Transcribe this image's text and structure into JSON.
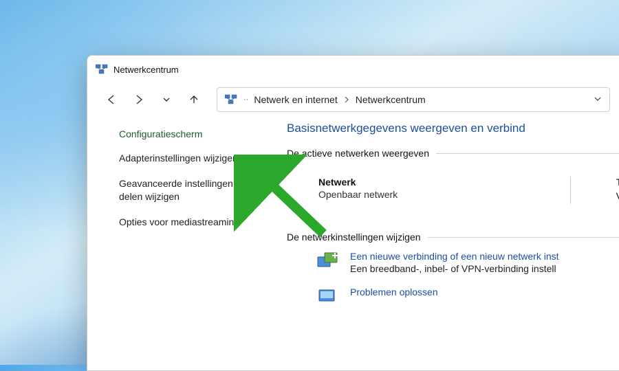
{
  "window": {
    "title": "Netwerkcentrum"
  },
  "breadcrumb": {
    "parent": "Netwerk en internet",
    "current": "Netwerkcentrum"
  },
  "sidebar": {
    "heading": "Configuratiescherm",
    "links": {
      "adapter": "Adapterinstellingen wijzigen",
      "advanced_sharing": "Geavanceerde instellingen voor delen wijzigen",
      "media_streaming": "Opties voor mediastreaming"
    }
  },
  "main": {
    "heading": "Basisnetwerkgegevens weergeven en verbind",
    "active_networks_label": "De actieve netwerken weergeven",
    "network": {
      "name": "Netwerk",
      "type": "Openbaar netwerk",
      "col1": "T",
      "col2": "V"
    },
    "change_settings_label": "De netwerkinstellingen wijzigen",
    "new_connection": {
      "link": "Een nieuwe verbinding of een nieuw netwerk inst",
      "desc": "Een breedband-, inbel- of VPN-verbinding instell"
    },
    "troubleshoot": {
      "link": "Problemen oplossen"
    }
  }
}
